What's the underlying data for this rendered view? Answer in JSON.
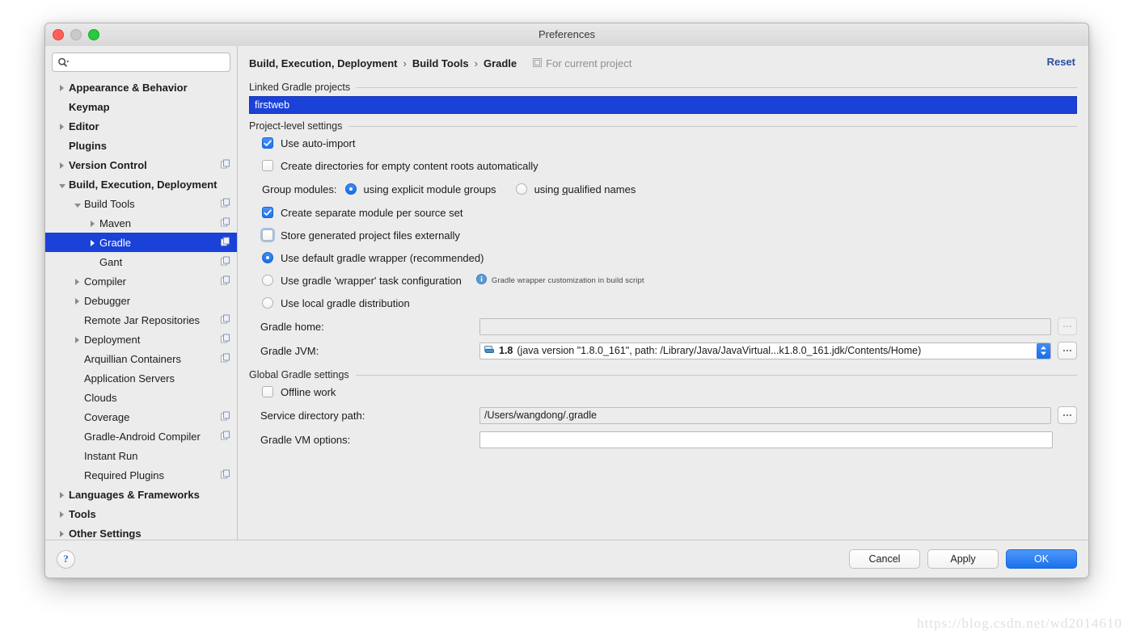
{
  "window": {
    "title": "Preferences",
    "traffic_lights": [
      "close-red",
      "minimize-gray",
      "zoom-green"
    ]
  },
  "sidebar": {
    "search": {
      "value": "",
      "placeholder": "",
      "icon": "search-icon"
    },
    "items": [
      {
        "label": "Appearance & Behavior",
        "indent": 0,
        "bold": true,
        "arrow": "right",
        "copy": false,
        "selected": false
      },
      {
        "label": "Keymap",
        "indent": 0,
        "bold": true,
        "arrow": "none",
        "copy": false,
        "selected": false
      },
      {
        "label": "Editor",
        "indent": 0,
        "bold": true,
        "arrow": "right",
        "copy": false,
        "selected": false
      },
      {
        "label": "Plugins",
        "indent": 0,
        "bold": true,
        "arrow": "none",
        "copy": false,
        "selected": false
      },
      {
        "label": "Version Control",
        "indent": 0,
        "bold": true,
        "arrow": "right",
        "copy": true,
        "selected": false
      },
      {
        "label": "Build, Execution, Deployment",
        "indent": 0,
        "bold": true,
        "arrow": "down",
        "copy": false,
        "selected": false
      },
      {
        "label": "Build Tools",
        "indent": 1,
        "bold": false,
        "arrow": "down",
        "copy": true,
        "selected": false
      },
      {
        "label": "Maven",
        "indent": 2,
        "bold": false,
        "arrow": "right",
        "copy": true,
        "selected": false
      },
      {
        "label": "Gradle",
        "indent": 2,
        "bold": false,
        "arrow": "right",
        "copy": true,
        "selected": true
      },
      {
        "label": "Gant",
        "indent": 2,
        "bold": false,
        "arrow": "none",
        "copy": true,
        "selected": false
      },
      {
        "label": "Compiler",
        "indent": 1,
        "bold": false,
        "arrow": "right",
        "copy": true,
        "selected": false
      },
      {
        "label": "Debugger",
        "indent": 1,
        "bold": false,
        "arrow": "right",
        "copy": false,
        "selected": false
      },
      {
        "label": "Remote Jar Repositories",
        "indent": 1,
        "bold": false,
        "arrow": "none",
        "copy": true,
        "selected": false
      },
      {
        "label": "Deployment",
        "indent": 1,
        "bold": false,
        "arrow": "right",
        "copy": true,
        "selected": false
      },
      {
        "label": "Arquillian Containers",
        "indent": 1,
        "bold": false,
        "arrow": "none",
        "copy": true,
        "selected": false
      },
      {
        "label": "Application Servers",
        "indent": 1,
        "bold": false,
        "arrow": "none",
        "copy": false,
        "selected": false
      },
      {
        "label": "Clouds",
        "indent": 1,
        "bold": false,
        "arrow": "none",
        "copy": false,
        "selected": false
      },
      {
        "label": "Coverage",
        "indent": 1,
        "bold": false,
        "arrow": "none",
        "copy": true,
        "selected": false
      },
      {
        "label": "Gradle-Android Compiler",
        "indent": 1,
        "bold": false,
        "arrow": "none",
        "copy": true,
        "selected": false
      },
      {
        "label": "Instant Run",
        "indent": 1,
        "bold": false,
        "arrow": "none",
        "copy": false,
        "selected": false
      },
      {
        "label": "Required Plugins",
        "indent": 1,
        "bold": false,
        "arrow": "none",
        "copy": true,
        "selected": false
      },
      {
        "label": "Languages & Frameworks",
        "indent": 0,
        "bold": true,
        "arrow": "right",
        "copy": false,
        "selected": false
      },
      {
        "label": "Tools",
        "indent": 0,
        "bold": true,
        "arrow": "right",
        "copy": false,
        "selected": false
      },
      {
        "label": "Other Settings",
        "indent": 0,
        "bold": true,
        "arrow": "right",
        "copy": false,
        "selected": false
      }
    ]
  },
  "header": {
    "breadcrumb": [
      "Build, Execution, Deployment",
      "Build Tools",
      "Gradle"
    ],
    "crumb_0": "Build, Execution, Deployment",
    "crumb_1": "Build Tools",
    "crumb_2": "Gradle",
    "separator": "›",
    "scope_label": "For current project",
    "scope_icon": "project-scope-icon",
    "reset_label": "Reset"
  },
  "main": {
    "linked_projects_label": "Linked Gradle projects",
    "linked_projects": [
      "firstweb"
    ],
    "selected_project": "firstweb",
    "project_settings_label": "Project-level settings",
    "use_auto_import": {
      "label": "Use auto-import",
      "checked": true
    },
    "create_dirs": {
      "label": "Create directories for empty content roots automatically",
      "checked": false
    },
    "group_modules": {
      "label": "Group modules:",
      "options": [
        "using explicit module groups",
        "using qualified names"
      ],
      "option_0": "using explicit module groups",
      "option_1": "using qualified names",
      "selected": 0
    },
    "separate_module": {
      "label": "Create separate module per source set",
      "checked": true
    },
    "store_external": {
      "label": "Store generated project files externally",
      "checked": false,
      "focused": true
    },
    "distribution": {
      "options": [
        "Use default gradle wrapper (recommended)",
        "Use gradle 'wrapper' task configuration",
        "Use local gradle distribution"
      ],
      "option_0": "Use default gradle wrapper (recommended)",
      "option_1": "Use gradle 'wrapper' task configuration",
      "option_2": "Use local gradle distribution",
      "selected": 0,
      "hint": "Gradle wrapper customization in build script",
      "hint_icon": "info-icon"
    },
    "gradle_home": {
      "label": "Gradle home:",
      "value": "",
      "browse": "…",
      "enabled": false
    },
    "gradle_jvm": {
      "label": "Gradle JVM:",
      "value": "1.8 (java version \"1.8.0_161\", path: /Library/Java/JavaVirtual...k1.8.0_161.jdk/Contents/Home)",
      "value_bold": "1.8",
      "value_rest": " (java version \"1.8.0_161\", path: /Library/Java/JavaVirtual...k1.8.0_161.jdk/Contents/Home)",
      "icon": "jdk-icon",
      "browse": "…"
    },
    "global_settings_label": "Global Gradle settings",
    "offline_work": {
      "label": "Offline work",
      "checked": false
    },
    "service_dir": {
      "label": "Service directory path:",
      "value": "/Users/wangdong/.gradle",
      "browse": "…"
    },
    "vm_options": {
      "label": "Gradle VM options:",
      "value": ""
    }
  },
  "footer": {
    "help_label": "?",
    "cancel_label": "Cancel",
    "apply_label": "Apply",
    "ok_label": "OK"
  },
  "watermark": "https://blog.csdn.net/wd2014610",
  "colors": {
    "selection_blue": "#1a41d8",
    "accent_blue": "#1f74ee",
    "link_blue": "#2b4e9b",
    "window_bg": "#ececec"
  }
}
